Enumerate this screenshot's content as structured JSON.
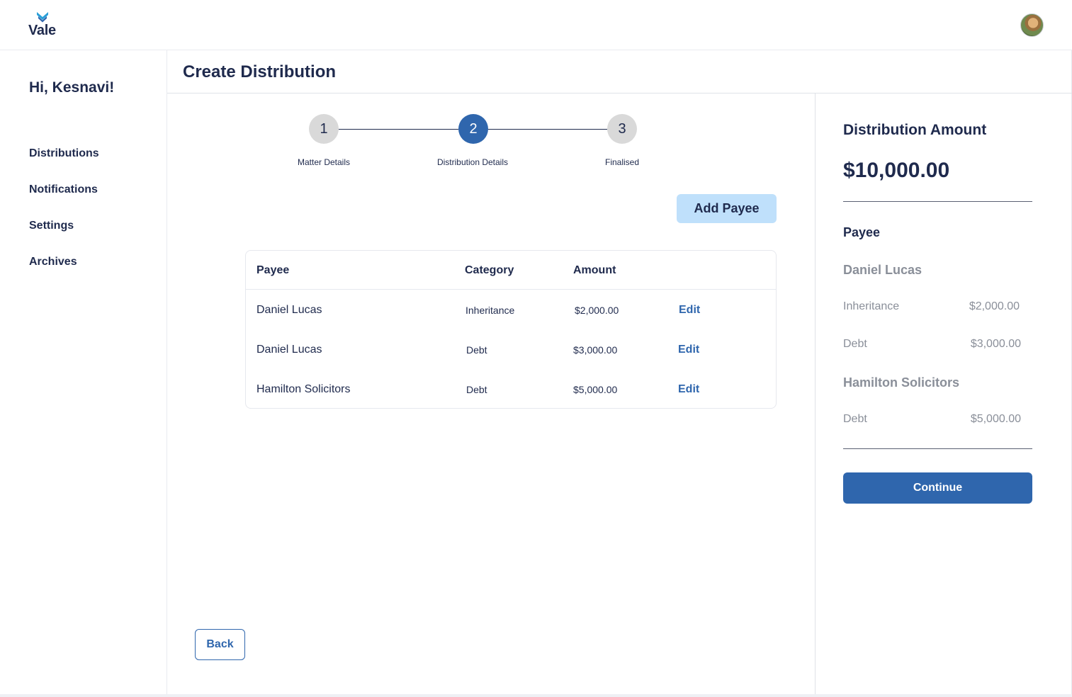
{
  "app": {
    "logo_text": "Vale",
    "brand_color": "#2f66ad",
    "accent_light": "#bfe0fb",
    "text_color": "#1f2a4d"
  },
  "sidebar": {
    "greeting": "Hi, Kesnavi!",
    "items": [
      {
        "label": "Distributions"
      },
      {
        "label": "Notifications"
      },
      {
        "label": "Settings"
      },
      {
        "label": "Archives"
      }
    ]
  },
  "header": {
    "title": "Create Distribution"
  },
  "stepper": {
    "current_step": 2,
    "steps": [
      {
        "number": "1",
        "label": "Matter Details",
        "state": "inactive"
      },
      {
        "number": "2",
        "label": "Distribution Details",
        "state": "active"
      },
      {
        "number": "3",
        "label": "Finalised",
        "state": "inactive"
      }
    ]
  },
  "actions": {
    "add_payee_label": "Add Payee",
    "back_label": "Back",
    "continue_label": "Continue"
  },
  "table": {
    "columns": [
      "Payee",
      "Category",
      "Amount"
    ],
    "rows": [
      {
        "payee": "Daniel Lucas",
        "category": "Inheritance",
        "amount": "$2,000.00",
        "action": "Edit"
      },
      {
        "payee": "Daniel Lucas",
        "category": "Debt",
        "amount": "$3,000.00",
        "action": "Edit"
      },
      {
        "payee": "Hamilton Solicitors",
        "category": "Debt",
        "amount": "$5,000.00",
        "action": "Edit"
      }
    ]
  },
  "summary": {
    "title": "Distribution Amount",
    "total": "$10,000.00",
    "payee_heading": "Payee",
    "groups": [
      {
        "name": "Daniel Lucas",
        "lines": [
          {
            "category": "Inheritance",
            "amount": "$2,000.00"
          },
          {
            "category": "Debt",
            "amount": "$3,000.00"
          }
        ]
      },
      {
        "name": "Hamilton Solicitors",
        "lines": [
          {
            "category": "Debt",
            "amount": "$5,000.00"
          }
        ]
      }
    ]
  },
  "icons": {
    "logo": "vale-chevron-logo-icon",
    "avatar": "user-avatar"
  }
}
